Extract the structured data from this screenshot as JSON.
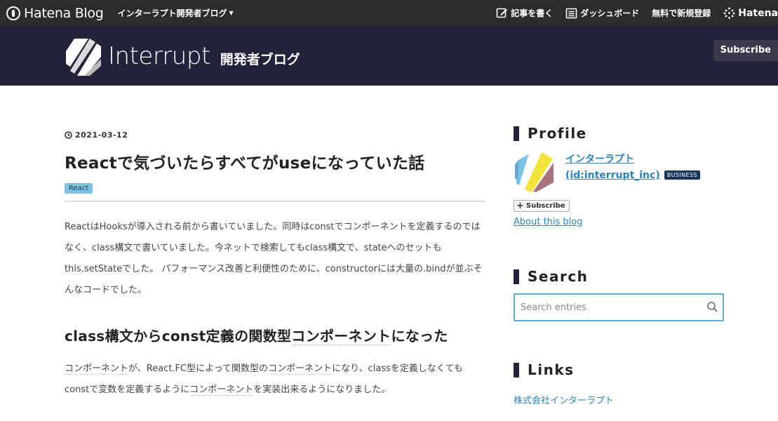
{
  "global_bar": {
    "logo_text": "Hatena Blog",
    "blog_menu_label": "インターラプト開発者ブログ",
    "links": {
      "write": "記事を書く",
      "dashboard": "ダッシュボード",
      "signup": "無料で新規登録",
      "hatena": "Hatena"
    }
  },
  "blog_header": {
    "wordmark": "Interrupt",
    "subtitle": "開発者ブログ",
    "subscribe_label": "Subscribe"
  },
  "article": {
    "date": "2021-03-12",
    "title": "Reactで気づいたらすべてがuseになっていた話",
    "category": "React",
    "paragraph1": "ReactはHooksが導入される前から書いていました。同時はconstでコンポーネントを定義するのではなく、class構文で書いていました。今ネットで検索してもclass構文で、stateへのセットもthis.setStateでした。 パフォーマンス改善と利便性のために、constructorには大量の.bindが並ぶそんなコードでした。",
    "heading2_pre": "class構文からconst定義の関数型",
    "heading2_kw": "コンポーネント",
    "heading2_post": "になった",
    "p2_kw1": "コンポーネント",
    "p2_text1": "が、React.FC型によって関数型の",
    "p2_kw2": "コンポーネント",
    "p2_text2": "になり、classを定義しなくてもconstで変数を定義するように",
    "p2_kw3": "コンポーネント",
    "p2_text3": "を実装出来るようになりました。"
  },
  "sidebar": {
    "profile_heading": "Profile",
    "profile_name": "インターラプト",
    "profile_id": "(id:interrupt_inc)",
    "badge": "BUSINESS",
    "subscribe_label": "Subscribe",
    "about_label": "About this blog",
    "search_heading": "Search",
    "search_placeholder": "Search entries",
    "links_heading": "Links",
    "link1": "株式会社インターラプト"
  },
  "colors": {
    "global_bar": "#2c2c2c",
    "header_bg": "#22223a",
    "link": "#2a82b8",
    "category_bg": "#7ec3e3",
    "search_border": "#5ea7cf"
  }
}
